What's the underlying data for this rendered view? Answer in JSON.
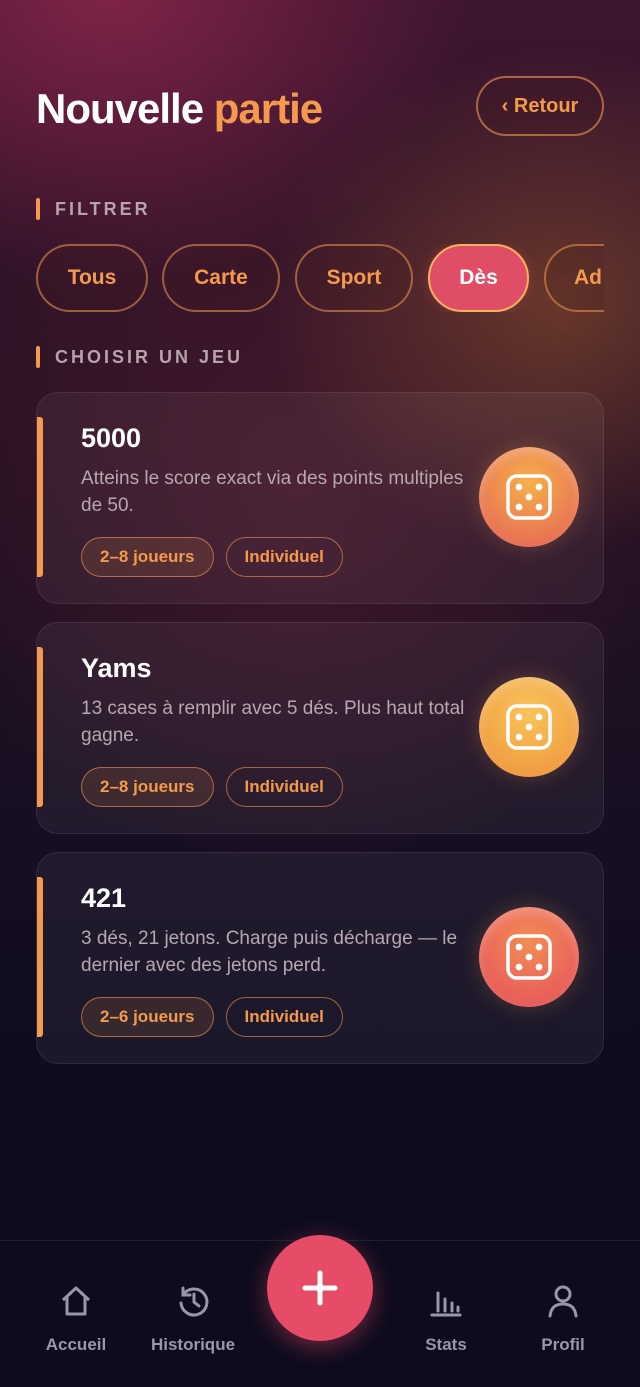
{
  "header": {
    "title_part1": "Nouvelle",
    "title_part2": "partie",
    "back_label": "‹ Retour"
  },
  "filter": {
    "label": "FILTRER",
    "chips": [
      {
        "label": "Tous",
        "active": false
      },
      {
        "label": "Carte",
        "active": false
      },
      {
        "label": "Sport",
        "active": false
      },
      {
        "label": "Dès",
        "active": true
      },
      {
        "label": "Ad",
        "active": false
      }
    ]
  },
  "games_section": {
    "label": "CHOISIR UN JEU"
  },
  "games": [
    {
      "name": "5000",
      "description": "Atteins le score exact via des points multiples de 50.",
      "players": "2–8 joueurs",
      "mode": "Individuel",
      "icon": "dice-icon"
    },
    {
      "name": "Yams",
      "description": "13 cases à remplir avec 5 dés. Plus haut total gagne.",
      "players": "2–8 joueurs",
      "mode": "Individuel",
      "icon": "dice-icon"
    },
    {
      "name": "421",
      "description": "3 dés, 21 jetons. Charge puis décharge — le dernier avec des jetons perd.",
      "players": "2–6 joueurs",
      "mode": "Individuel",
      "icon": "dice-icon"
    }
  ],
  "nav": {
    "items": [
      {
        "label": "Accueil",
        "icon": "home-icon"
      },
      {
        "label": "Historique",
        "icon": "history-icon"
      },
      {
        "label": "Stats",
        "icon": "stats-icon"
      },
      {
        "label": "Profil",
        "icon": "profile-icon"
      }
    ],
    "fab_icon": "plus-icon"
  },
  "colors": {
    "accent": "#f39a4c",
    "primary": "#e64b67",
    "background": "#0c0b1c"
  }
}
